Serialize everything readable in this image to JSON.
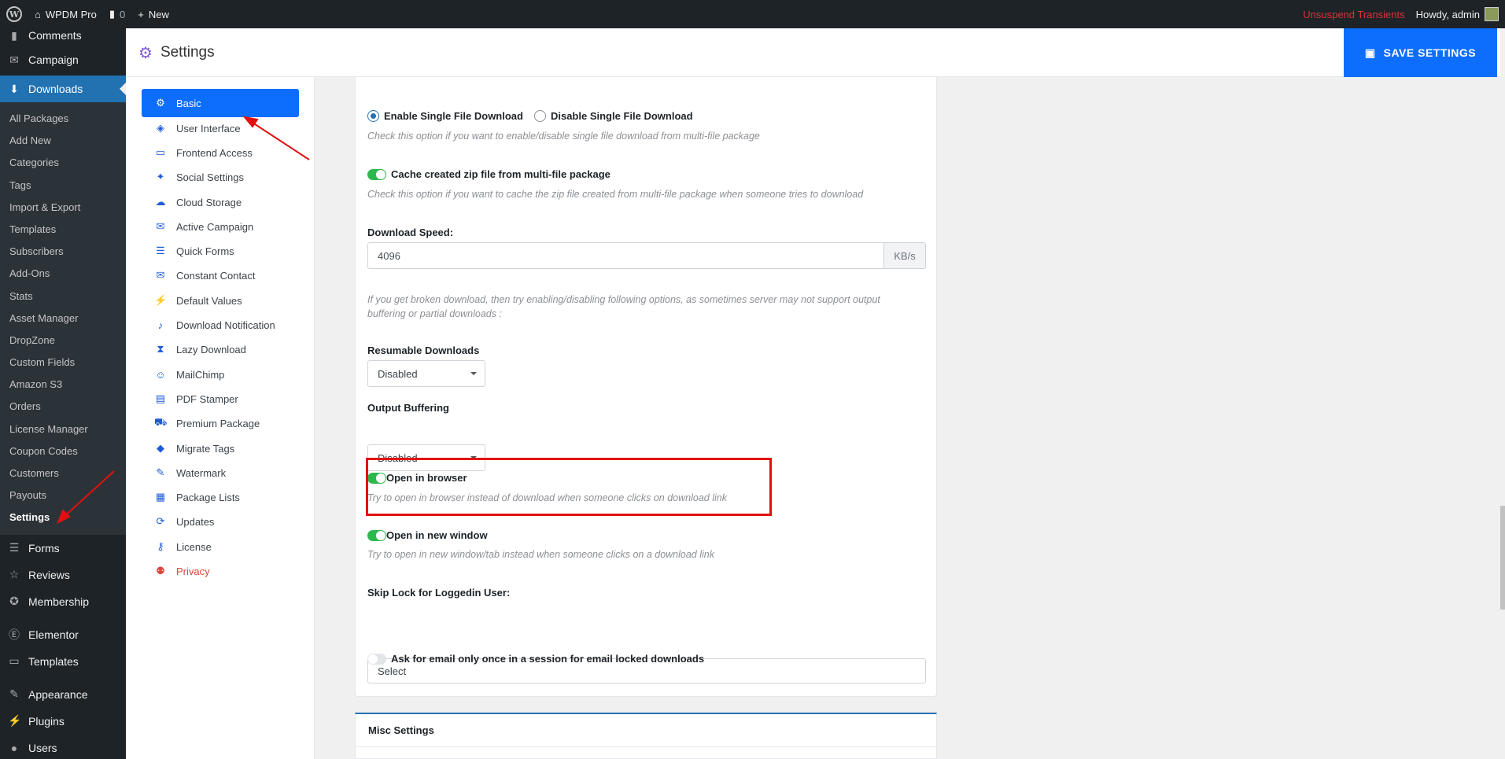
{
  "adminbar": {
    "site_name": "WPDM Pro",
    "comments_count": "0",
    "new_label": "New",
    "transients_label": "Unsuspend Transients",
    "howdy": "Howdy, admin"
  },
  "menu": {
    "comments": "Comments",
    "campaign": "Campaign",
    "downloads": "Downloads",
    "downloads_sub": [
      "All Packages",
      "Add New",
      "Categories",
      "Tags",
      "Import & Export",
      "Templates",
      "Subscribers",
      "Add-Ons",
      "Stats",
      "Asset Manager",
      "DropZone",
      "Custom Fields",
      "Amazon S3",
      "Orders",
      "License Manager",
      "Coupon Codes",
      "Customers",
      "Payouts",
      "Settings"
    ],
    "forms": "Forms",
    "reviews": "Reviews",
    "membership": "Membership",
    "elementor": "Elementor",
    "templates": "Templates",
    "appearance": "Appearance",
    "plugins": "Plugins",
    "users": "Users"
  },
  "header": {
    "title": "Settings",
    "save_label": "SAVE SETTINGS"
  },
  "settings_nav": [
    {
      "label": "Basic",
      "icon": "gear-icon"
    },
    {
      "label": "User Interface",
      "icon": "paint-bucket-icon"
    },
    {
      "label": "Frontend Access",
      "icon": "monitor-icon"
    },
    {
      "label": "Social Settings",
      "icon": "twitter-icon"
    },
    {
      "label": "Cloud Storage",
      "icon": "cloud-icon"
    },
    {
      "label": "Active Campaign",
      "icon": "envelope-icon"
    },
    {
      "label": "Quick Forms",
      "icon": "list-icon"
    },
    {
      "label": "Constant Contact",
      "icon": "envelope-icon"
    },
    {
      "label": "Default Values",
      "icon": "bolt-icon"
    },
    {
      "label": "Download Notification",
      "icon": "bell-icon"
    },
    {
      "label": "Lazy Download",
      "icon": "hourglass-icon"
    },
    {
      "label": "MailChimp",
      "icon": "mailchimp-icon"
    },
    {
      "label": "PDF Stamper",
      "icon": "pdf-icon"
    },
    {
      "label": "Premium Package",
      "icon": "cart-icon"
    },
    {
      "label": "Migrate Tags",
      "icon": "tags-icon"
    },
    {
      "label": "Watermark",
      "icon": "pen-icon"
    },
    {
      "label": "Package Lists",
      "icon": "list-box-icon"
    },
    {
      "label": "Updates",
      "icon": "sync-icon"
    },
    {
      "label": "License",
      "icon": "key-icon"
    },
    {
      "label": "Privacy",
      "icon": "user-shield-icon"
    }
  ],
  "content": {
    "single_file": {
      "enable_label": "Enable Single File Download",
      "disable_label": "Disable Single File Download",
      "hint": "Check this option if you want to enable/disable single file download from multi-file package"
    },
    "cache_zip": {
      "label": "Cache created zip file from multi-file package",
      "hint": "Check this option if you want to cache the zip file created from multi-file package when someone tries to download"
    },
    "speed": {
      "label": "Download Speed:",
      "value": "4096",
      "unit": "KB/s"
    },
    "broken_hint": "If you get broken download, then try enabling/disabling following options, as sometimes server may not support output buffering or partial downloads :",
    "resumable": {
      "label": "Resumable Downloads",
      "value": "Disabled"
    },
    "output_buffering": {
      "label": "Output Buffering",
      "value": "Disabled"
    },
    "open_browser": {
      "label": "Open in browser",
      "hint": "Try to open in browser instead of download when someone clicks on download link"
    },
    "open_new_window": {
      "label": "Open in new window",
      "hint": "Try to open in new window/tab instead when someone clicks on a download link"
    },
    "skip_lock": {
      "label": "Skip Lock for Loggedin User:",
      "placeholder": "Select"
    },
    "email_once": {
      "label": "Ask for email only once in a session for email locked downloads"
    }
  },
  "misc": {
    "title": "Misc Settings"
  },
  "colors": {
    "accent": "#0d6efd",
    "wp_blue": "#2271b1",
    "annotation_red": "#e21010",
    "toggle_on": "#2db84d"
  }
}
